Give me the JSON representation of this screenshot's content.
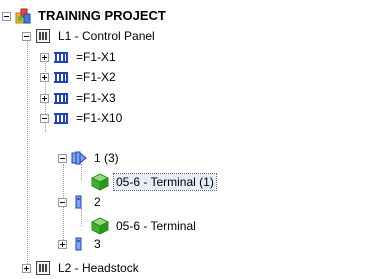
{
  "tree": {
    "root": "TRAINING PROJECT",
    "l1": "L1 - Control Panel",
    "f1x1": "=F1-X1",
    "f1x2": "=F1-X2",
    "f1x3": "=F1-X3",
    "f1x10": "=F1-X10",
    "n1": "1 (3)",
    "term1": "05-6 - Terminal (1)",
    "n2": "2",
    "term2": "05-6 - Terminal",
    "n3": "3",
    "l2": "L2 - Headstock"
  },
  "icons": {
    "root": "project-folder-icon",
    "panel": "panel-location-icon",
    "strip": "terminal-strip-icon",
    "multi": "multi-level-terminal-icon",
    "terminal": "terminal-icon",
    "part": "green-part-cube-icon"
  }
}
